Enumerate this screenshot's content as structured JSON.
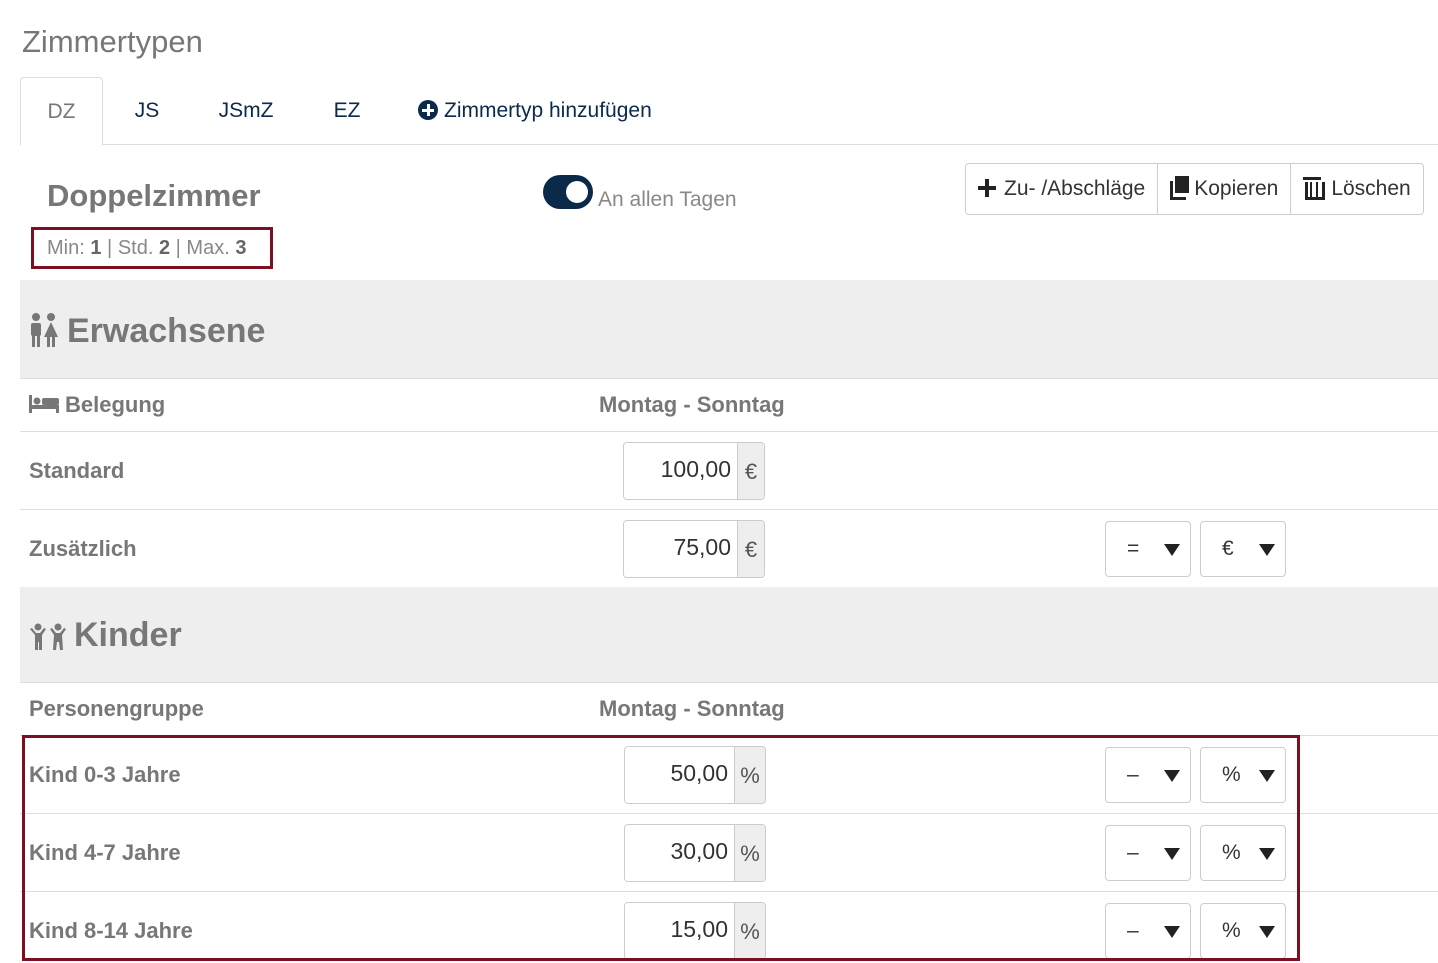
{
  "page": {
    "title": "Zimmertypen"
  },
  "tabs": [
    {
      "label": "DZ",
      "active": true
    },
    {
      "label": "JS"
    },
    {
      "label": "JSmZ"
    },
    {
      "label": "EZ"
    }
  ],
  "add_tab": {
    "icon": "plus-circle-icon",
    "label": "Zimmertyp hinzufügen"
  },
  "room": {
    "name": "Doppelzimmer",
    "occupancy": {
      "min_label": "Min:",
      "min": "1",
      "std_label": "Std.",
      "std": "2",
      "max_label": "Max.",
      "max": "3",
      "separator": "|"
    },
    "toggle": {
      "on": true,
      "label": "An allen Tagen"
    },
    "actions": {
      "surcharges": "Zu- /Abschläge",
      "copy": "Kopieren",
      "delete": "Löschen"
    }
  },
  "adults": {
    "title": "Erwachsene",
    "icon": "people-icon",
    "header": {
      "label": "Belegung",
      "icon": "bed-icon",
      "column": "Montag - Sonntag"
    },
    "rows": [
      {
        "label": "Standard",
        "value": "100,00",
        "unit": "€"
      },
      {
        "label": "Zusätzlich",
        "value": "75,00",
        "unit": "€",
        "operator": "=",
        "operator_unit": "€"
      }
    ]
  },
  "children": {
    "title": "Kinder",
    "icon": "child-icon",
    "header": {
      "label": "Personengruppe",
      "column": "Montag - Sonntag"
    },
    "rows": [
      {
        "label": "Kind 0-3 Jahre",
        "value": "50,00",
        "unit": "%",
        "operator": "–",
        "operator_unit": "%"
      },
      {
        "label": "Kind 4-7 Jahre",
        "value": "30,00",
        "unit": "%",
        "operator": "–",
        "operator_unit": "%"
      },
      {
        "label": "Kind 8-14 Jahre",
        "value": "15,00",
        "unit": "%",
        "operator": "–",
        "operator_unit": "%"
      }
    ]
  },
  "colors": {
    "primary": "#0b2a4a",
    "highlight": "#7a1020",
    "section_bg": "#eeeeee"
  }
}
